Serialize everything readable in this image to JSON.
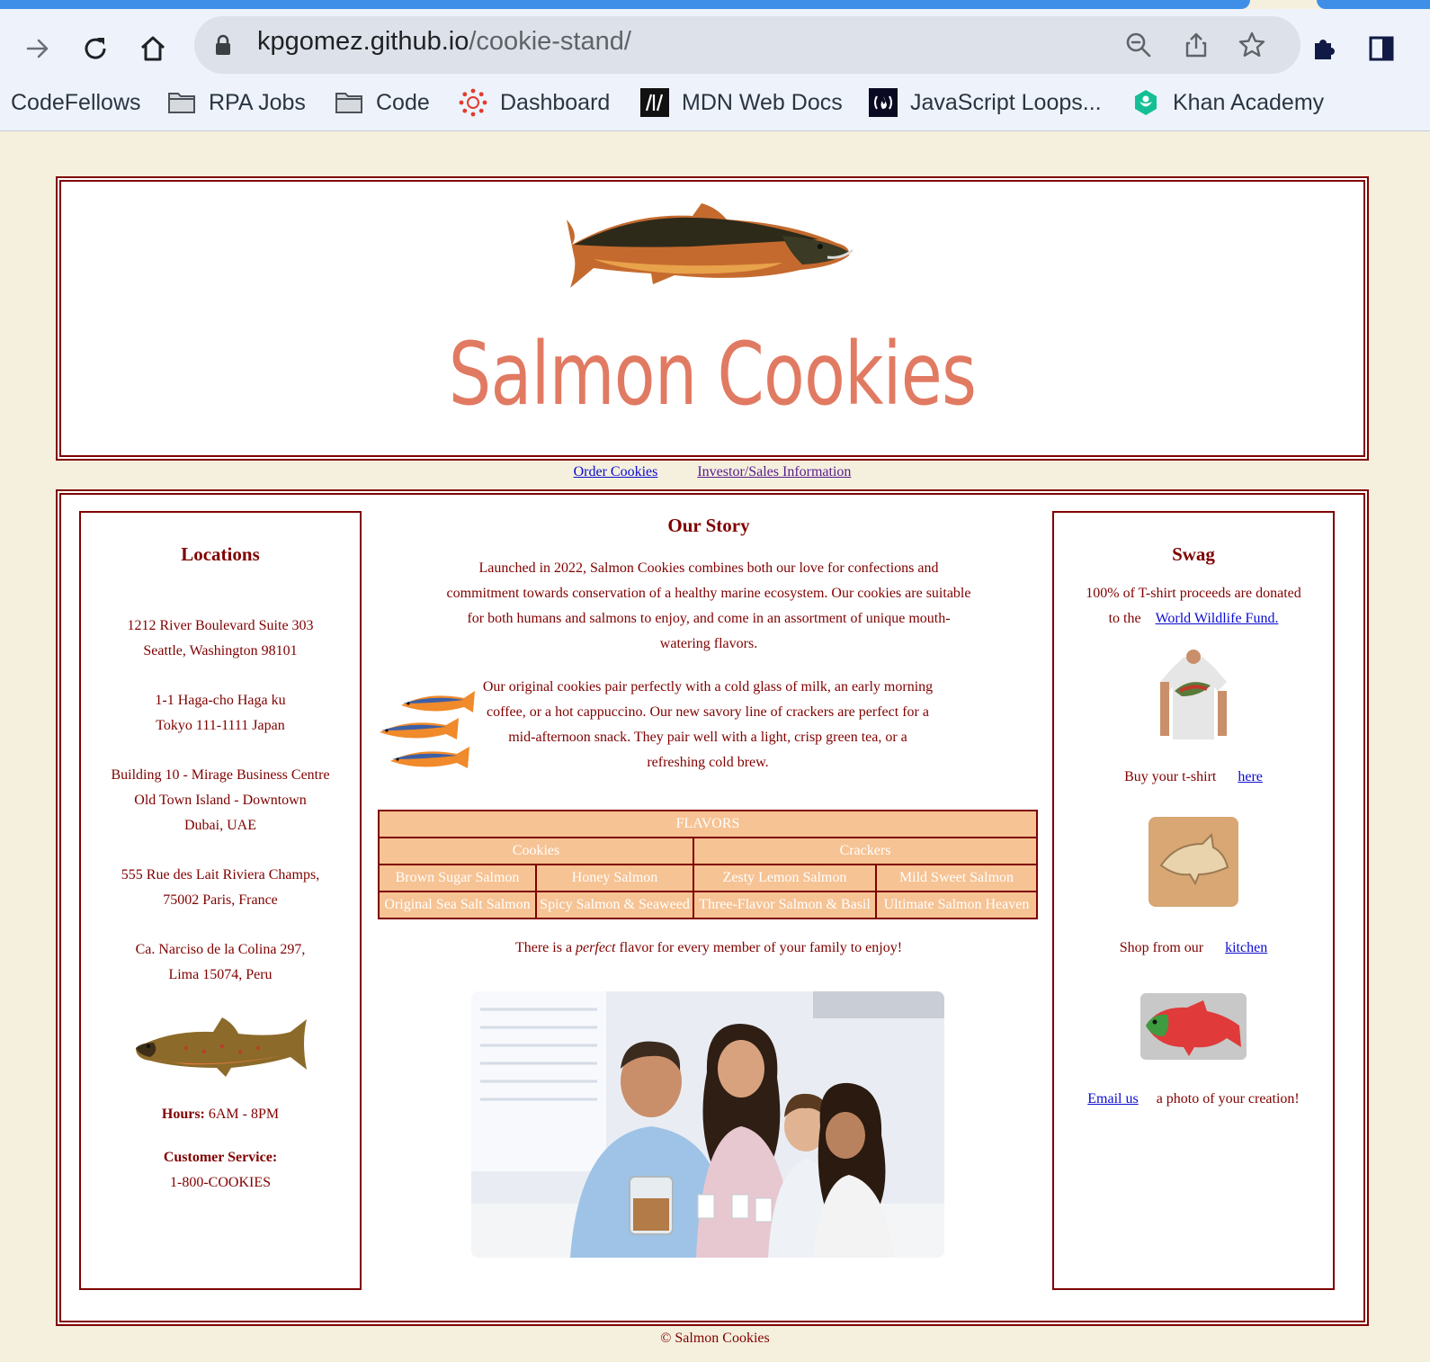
{
  "browser": {
    "url_host": "kpgomez.github.io",
    "url_path": "/cookie-stand/",
    "bookmarks": [
      {
        "label": "CodeFellows",
        "icon": "none"
      },
      {
        "label": "RPA Jobs",
        "icon": "folder-icon"
      },
      {
        "label": "Code",
        "icon": "folder-icon"
      },
      {
        "label": "Dashboard",
        "icon": "canvas-icon"
      },
      {
        "label": "MDN Web Docs",
        "icon": "mdn-icon"
      },
      {
        "label": "JavaScript Loops...",
        "icon": "freecodecamp-icon"
      },
      {
        "label": "Khan Academy",
        "icon": "khan-academy-icon"
      }
    ]
  },
  "header": {
    "title": "Salmon Cookies"
  },
  "nav": {
    "order": "Order Cookies",
    "investor": "Investor/Sales Information"
  },
  "locations": {
    "title": "Locations",
    "addresses": [
      [
        "1212 River Boulevard Suite 303",
        "Seattle, Washington 98101"
      ],
      [
        "1-1 Haga-cho Haga ku",
        "Tokyo 111-1111 Japan"
      ],
      [
        "Building 10 - Mirage Business Centre",
        "Old Town Island - Downtown",
        "Dubai, UAE"
      ],
      [
        "555 Rue des Lait Riviera Champs,",
        "75002 Paris, France"
      ],
      [
        "Ca. Narciso de la Colina 297,",
        "Lima 15074, Peru"
      ]
    ],
    "hours_label": "Hours:",
    "hours_value": "6AM - 8PM",
    "service_label": "Customer Service:",
    "service_value": "1-800-COOKIES"
  },
  "story": {
    "title": "Our Story",
    "p1": "Launched in 2022, Salmon Cookies combines both our love for confections and commitment towards conservation of a healthy marine ecosystem. Our cookies are suitable for both humans and salmons to enjoy, and come in an assortment of unique mouth-watering flavors.",
    "p2": "Our original cookies pair perfectly with a cold glass of milk, an early morning coffee, or a hot cappuccino. Our new savory line of crackers are perfect for a mid-afternoon snack. They pair well with a light, crisp green tea, or a refreshing cold brew.",
    "tagline_pre": "There is a ",
    "tagline_em": "perfect",
    "tagline_post": " flavor for every member of your family to enjoy!"
  },
  "flavors": {
    "title": "FLAVORS",
    "groups": [
      "Cookies",
      "Crackers"
    ],
    "rows": [
      [
        "Brown Sugar Salmon",
        "Honey Salmon",
        "Zesty Lemon Salmon",
        "Mild Sweet Salmon"
      ],
      [
        "Original Sea Salt Salmon",
        "Spicy Salmon & Seaweed",
        "Three-Flavor Salmon & Basil",
        "Ultimate Salmon Heaven"
      ]
    ]
  },
  "swag": {
    "title": "Swag",
    "proceeds_text": "100% of T-shirt proceeds are donated to the",
    "wwf_link": "World Wildlife Fund.",
    "tshirt_text": "Buy your t-shirt",
    "tshirt_link": "here",
    "kitchen_text": "Shop from our",
    "kitchen_link": "kitchen",
    "email_link": "Email us",
    "email_text": "a photo of your creation!"
  },
  "footer": {
    "text": "© Salmon Cookies"
  }
}
